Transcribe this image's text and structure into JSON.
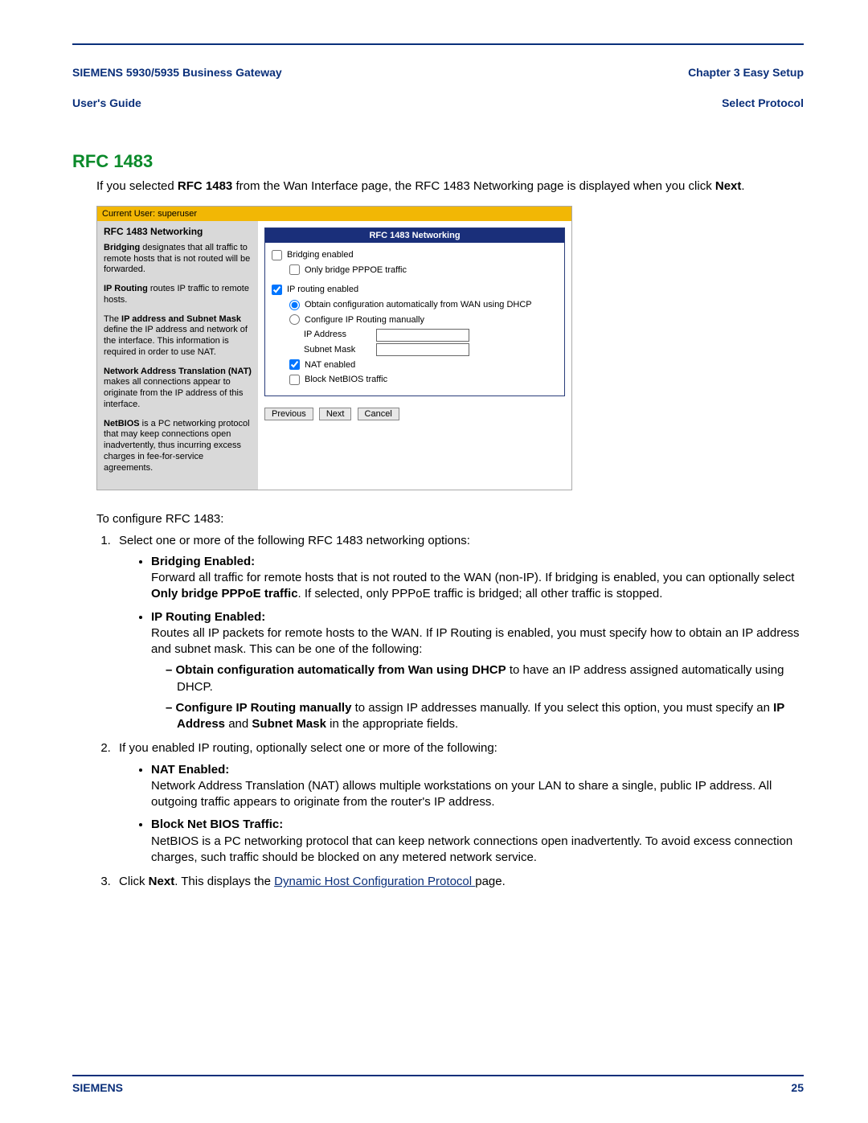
{
  "header": {
    "left_line1": "SIEMENS 5930/5935 Business Gateway",
    "left_line2": "User's Guide",
    "right_line1": "Chapter 3  Easy Setup",
    "right_line2": "Select Protocol"
  },
  "section_title": "RFC 1483",
  "intro_parts": {
    "p1": "If you selected ",
    "p1b": "RFC 1483",
    "p2": " from the Wan Interface page, the RFC 1483 Networking page is displayed when you click ",
    "p2b": "Next",
    "p3": "."
  },
  "shot": {
    "user_bar": "Current User: superuser",
    "side": {
      "title": "RFC 1483 Networking",
      "p1a": "Bridging",
      "p1b": " designates that all traffic to remote hosts that is not routed will be forwarded.",
      "p2a": "IP Routing",
      "p2b": " routes IP traffic to remote hosts.",
      "p3a": "The ",
      "p3b": "IP address and Subnet Mask",
      "p3c": " define the IP address and network of the interface. This information is required in order to use NAT.",
      "p4a": "Network Address Translation (NAT)",
      "p4b": " makes all connections appear to originate from the IP address of this interface.",
      "p5a": "NetBIOS",
      "p5b": " is a PC networking protocol that may keep connections open inadvertently, thus incurring excess charges in fee-for-service agreements."
    },
    "panel": {
      "title": "RFC 1483 Networking",
      "bridging": "Bridging enabled",
      "only_pppoe": "Only bridge PPPOE traffic",
      "iprouting": "IP routing enabled",
      "obtain": "Obtain configuration automatically from WAN using DHCP",
      "manual": "Configure IP Routing manually",
      "ipaddr_label": "IP Address",
      "subnet_label": "Subnet Mask",
      "nat": "NAT enabled",
      "block": "Block NetBIOS traffic",
      "btn_prev": "Previous",
      "btn_next": "Next",
      "btn_cancel": "Cancel"
    }
  },
  "body": {
    "lead": "To configure RFC 1483:",
    "step1": "Select one or more of the following RFC 1483 networking options:",
    "b1_title": "Bridging Enabled:",
    "b1_p1": "Forward all traffic for remote hosts that is not routed to the WAN (non-IP). If bridging is enabled, you can optionally select ",
    "b1_bold": "Only bridge PPPoE traffic",
    "b1_p2": ". If selected, only PPPoE traffic is bridged; all other traffic is stopped.",
    "b2_title": "IP Routing Enabled:",
    "b2_text": "Routes all IP packets for remote hosts to the WAN. If IP Routing is enabled, you must specify how to obtain an IP address and subnet mask. This can be one of the following:",
    "d1_bold": "Obtain configuration automatically from Wan using DHCP",
    "d1_rest": " to have an IP address assigned automatically using DHCP.",
    "d2_bold": "Configure IP Routing manually",
    "d2_mid": " to assign IP addresses manually. If you select this option, you must specify an ",
    "d2_ip": "IP Address",
    "d2_and": " and ",
    "d2_sm": "Subnet Mask",
    "d2_end": " in the appropriate fields.",
    "step2": "If you enabled IP routing, optionally select one or more of the following:",
    "b3_title": "NAT Enabled:",
    "b3_text": "Network Address Translation (NAT) allows multiple workstations on your LAN to share a single, public IP address. All outgoing traffic appears to originate from the router's IP address.",
    "b4_title": "Block Net BIOS Traffic:",
    "b4_text": "NetBIOS is a PC networking protocol that can keep network connections open inadvertently. To avoid excess connection charges, such traffic should be blocked on any metered network service.",
    "step3_a": "Click ",
    "step3_b": "Next",
    "step3_c": ". This displays the ",
    "step3_link": "Dynamic Host Configuration Protocol ",
    "step3_d": "page."
  },
  "footer": {
    "brand": "SIEMENS",
    "page": "25"
  }
}
